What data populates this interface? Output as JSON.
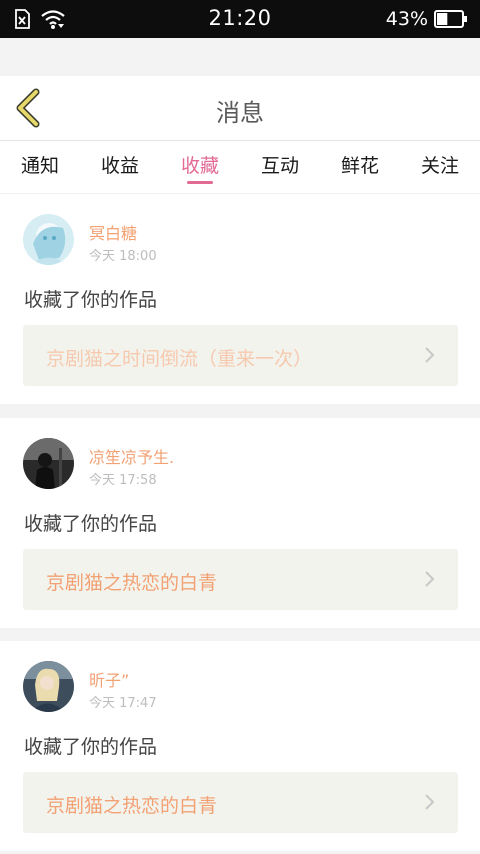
{
  "status_bar": {
    "time": "21:20",
    "battery_percent": "43%",
    "battery_level": 0.43,
    "icons": [
      "sim-off-icon",
      "wifi-icon",
      "battery-icon"
    ]
  },
  "header": {
    "title": "消息",
    "back_icon": "chevron-left-icon"
  },
  "tabs": [
    {
      "label": "通知"
    },
    {
      "label": "收益"
    },
    {
      "label": "收藏"
    },
    {
      "label": "互动"
    },
    {
      "label": "鲜花"
    },
    {
      "label": "关注"
    }
  ],
  "active_tab": "收藏",
  "notifications": [
    {
      "user": "冥白糖",
      "time": "今天 18:00",
      "action": "收藏了你的作品",
      "work_title": "京剧猫之时间倒流（重来一次）"
    },
    {
      "user": "凉笙凉予生.",
      "time": "今天 17:58",
      "action": "收藏了你的作品",
      "work_title": "京剧猫之热恋的白青"
    },
    {
      "user": "昕子”",
      "time": "今天 17:47",
      "action": "收藏了你的作品",
      "work_title": "京剧猫之热恋的白青"
    }
  ],
  "colors": {
    "accent": "#e26a95",
    "name_orange": "#f2a173",
    "back_arrow": "#e6d86a"
  }
}
